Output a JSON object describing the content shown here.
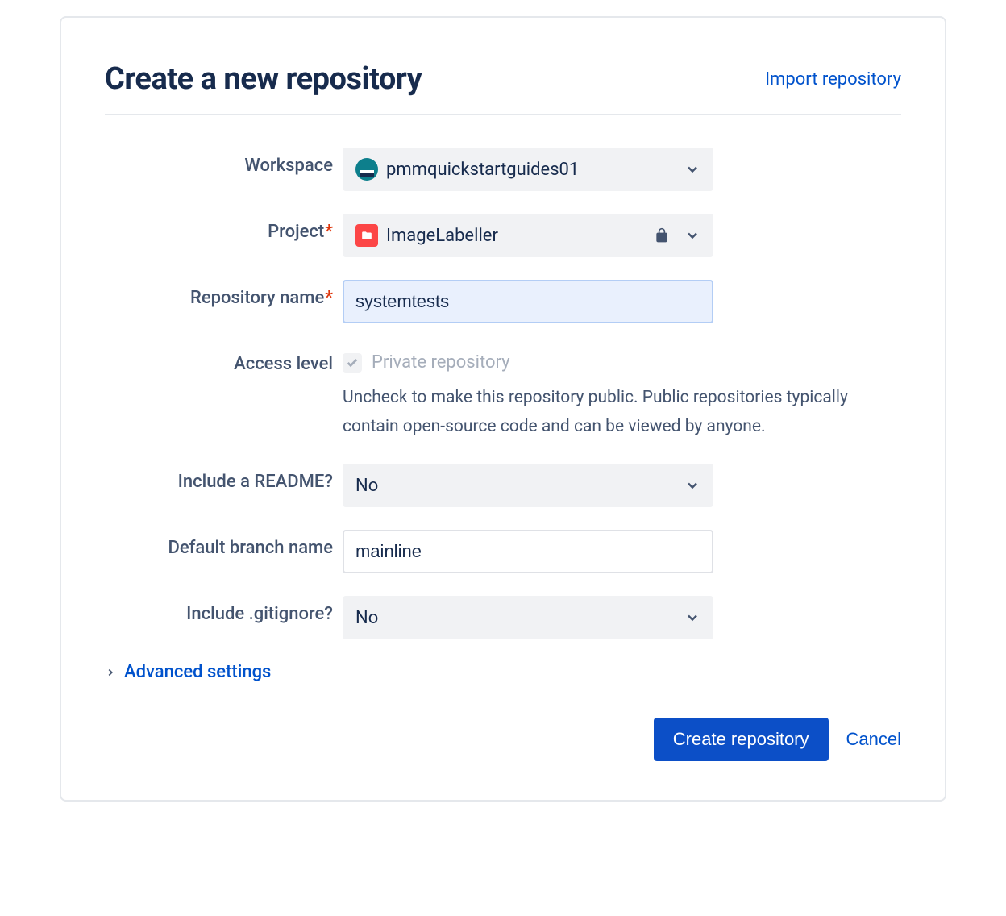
{
  "header": {
    "title": "Create a new repository",
    "import_link": "Import repository"
  },
  "form": {
    "workspace": {
      "label": "Workspace",
      "value": "pmmquickstartguides01"
    },
    "project": {
      "label": "Project",
      "value": "ImageLabeller",
      "required": true
    },
    "repo_name": {
      "label": "Repository name",
      "value": "systemtests",
      "required": true
    },
    "access_level": {
      "label": "Access level",
      "checkbox_label": "Private repository",
      "checked": true,
      "disabled": true,
      "help_text": "Uncheck to make this repository public. Public repositories typically contain open-source code and can be viewed by anyone."
    },
    "readme": {
      "label": "Include a README?",
      "value": "No"
    },
    "branch": {
      "label": "Default branch name",
      "value": "mainline"
    },
    "gitignore": {
      "label": "Include .gitignore?",
      "value": "No"
    },
    "advanced_label": "Advanced settings"
  },
  "actions": {
    "create": "Create repository",
    "cancel": "Cancel"
  }
}
